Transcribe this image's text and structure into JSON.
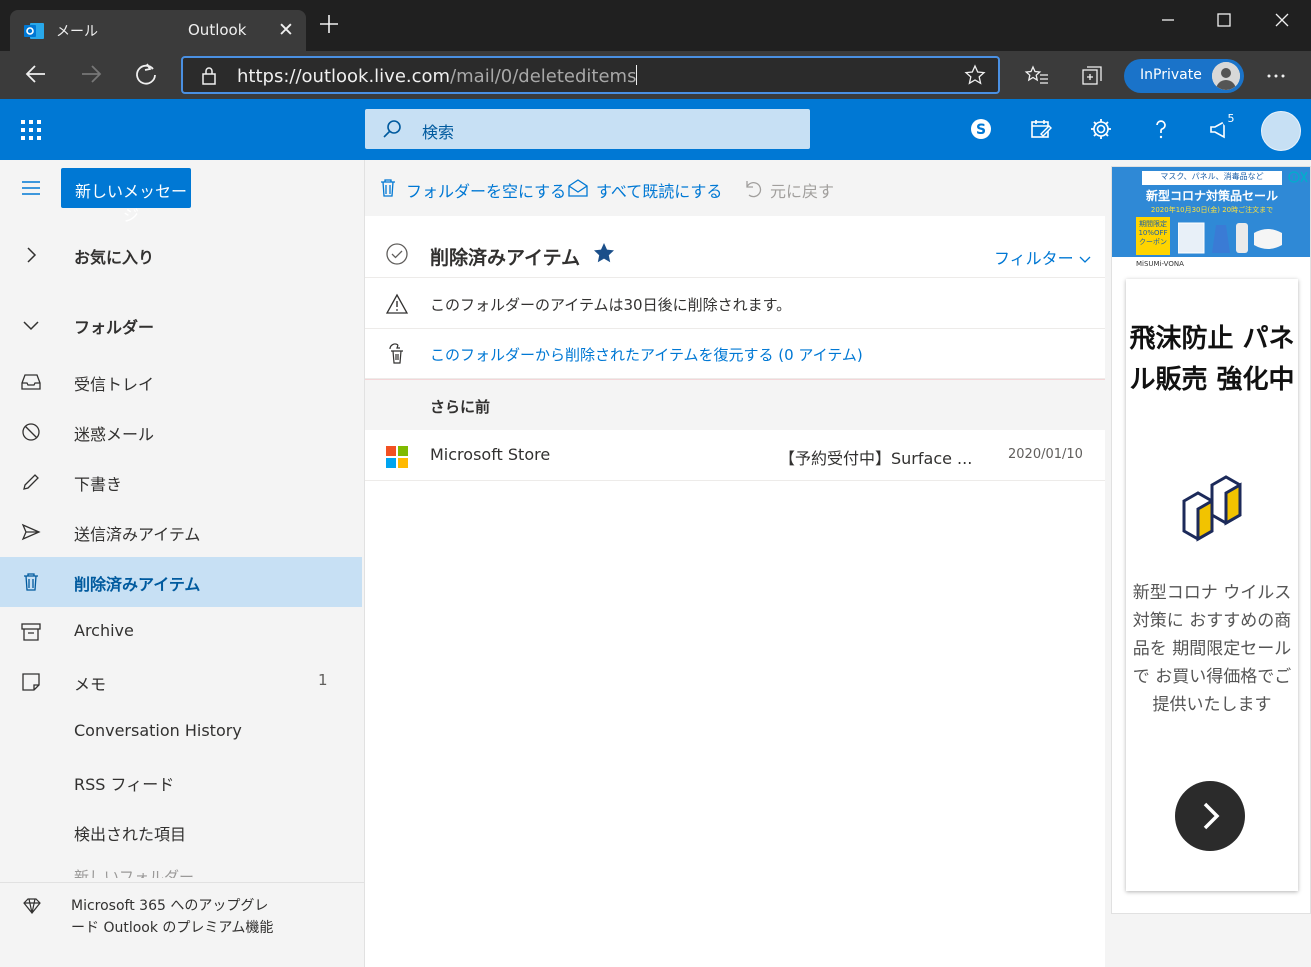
{
  "browser": {
    "tab_section": "メール",
    "tab_title": "Outlook",
    "url_scheme": "https://",
    "url_host": "outlook.live.com",
    "url_path": "/mail/0/deleteditems",
    "inprivate_label": "InPrivate"
  },
  "header": {
    "search_placeholder": "検索",
    "notification_count": "5",
    "accent_color": "#0078d4"
  },
  "leftnav": {
    "new_message": "新しいメッセージ",
    "favorites": "お気に入り",
    "folders": "フォルダー",
    "items": [
      {
        "label": "受信トレイ",
        "icon": "inbox-icon"
      },
      {
        "label": "迷惑メール",
        "icon": "junk-icon"
      },
      {
        "label": "下書き",
        "icon": "drafts-icon"
      },
      {
        "label": "送信済みアイテム",
        "icon": "sent-icon"
      },
      {
        "label": "削除済みアイテム",
        "icon": "trash-icon",
        "selected": true
      },
      {
        "label": "Archive",
        "icon": "archive-icon"
      },
      {
        "label": "メモ",
        "icon": "notes-icon",
        "count": "1"
      },
      {
        "label": "Conversation History"
      },
      {
        "label": "RSS フィード"
      },
      {
        "label": "検出された項目"
      }
    ],
    "more_partial": "新しいフォルダー",
    "upgrade": "Microsoft 365 へのアップグレード Outlook のプレミアム機能"
  },
  "commands": {
    "empty_folder": "フォルダーを空にする",
    "mark_all_read": "すべて既読にする",
    "undo": "元に戻す"
  },
  "list": {
    "title": "削除済みアイテム",
    "filter": "フィルター",
    "notice": "このフォルダーのアイテムは30日後に削除されます。",
    "recover": "このフォルダーから削除されたアイテムを復元する (0 アイテム)",
    "group": "さらに前",
    "messages": [
      {
        "from": "Microsoft Store",
        "subject": "【予約受付中】Surface ...",
        "date": "2020/01/10"
      }
    ]
  },
  "ad": {
    "banner_top": "マスク、パネル、消毒品など",
    "banner_title": "新型コロナ対策品セール",
    "banner_date": "2020年10月30日(金) 20時ご注文まで",
    "coupon": "期間限定 10%OFF クーポン",
    "banner_brand": "MiSUMi-VONA",
    "headline": "飛沫防止 パネル販売 強化中",
    "body": "新型コロナ ウイルス対策に おすすめの商品を 期間限定セールで お買い得価格でご 提供いたします"
  }
}
